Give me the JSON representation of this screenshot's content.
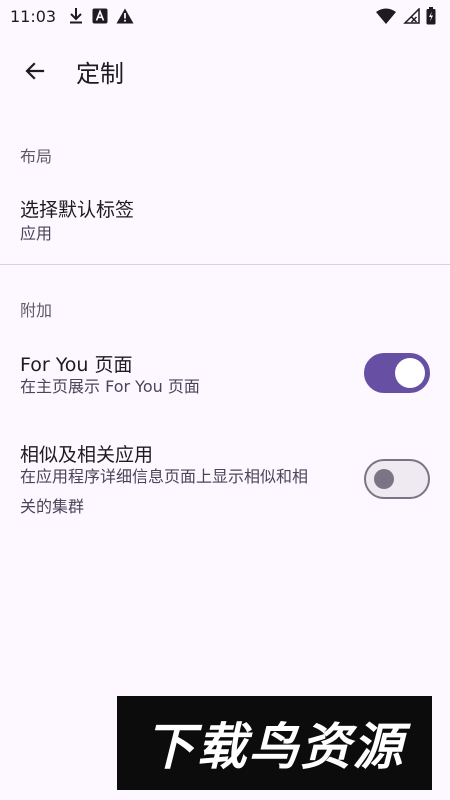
{
  "status_bar": {
    "time": "11:03",
    "icons_left": [
      "download-icon",
      "font-a-icon",
      "warning-icon"
    ],
    "icons_right": [
      "wifi-icon",
      "no-signal-icon",
      "battery-icon"
    ]
  },
  "app_bar": {
    "title": "定制",
    "back_icon": "arrow-back-icon"
  },
  "sections": {
    "layout": {
      "header": "布局",
      "default_tab": {
        "title": "选择默认标签",
        "value": "应用"
      }
    },
    "extras": {
      "header": "附加",
      "for_you": {
        "title": "For You 页面",
        "subtitle": "在主页展示 For You 页面",
        "enabled": true
      },
      "similar": {
        "title": "相似及相关应用",
        "subtitle_line1": "在应用程序详细信息页面上显示相似和相",
        "subtitle_line2": "关的集群",
        "enabled": false
      }
    }
  },
  "watermark": {
    "text": "下载鸟资源"
  },
  "colors": {
    "background": "#FDF7FF",
    "accent": "#6750A4",
    "switch_off_track": "#EFEAF2",
    "switch_off_outline": "#7B7484"
  }
}
